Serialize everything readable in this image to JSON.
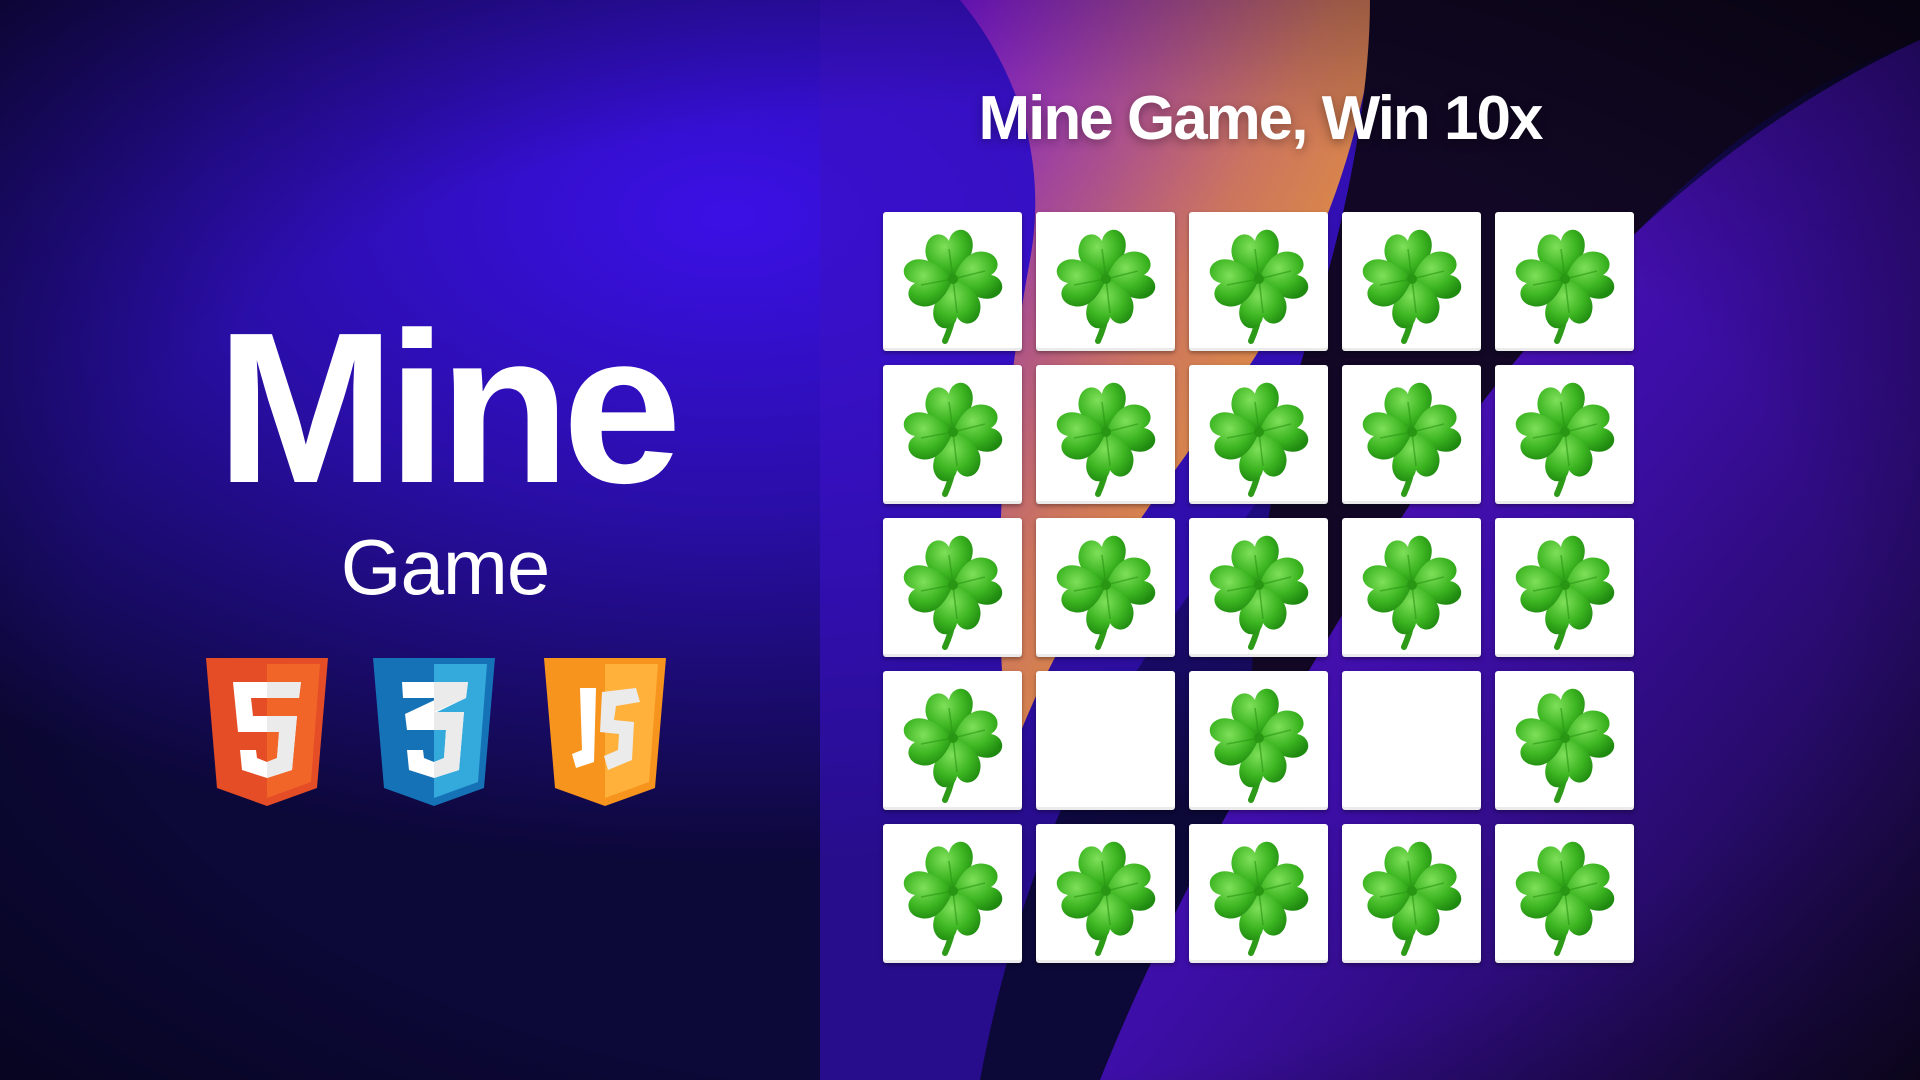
{
  "hero": {
    "title": "Mine",
    "subtitle": "Game",
    "badges": [
      {
        "name": "html5-icon",
        "glyph": "5",
        "color_light": "#f16529",
        "color_dark": "#e44d26"
      },
      {
        "name": "css3-icon",
        "glyph": "3",
        "color_light": "#33a9dc",
        "color_dark": "#1572b6"
      },
      {
        "name": "javascript-icon",
        "glyph": "JS",
        "color_light": "#ffb13b",
        "color_dark": "#f7941d"
      }
    ]
  },
  "game": {
    "title": "Mine Game, Win 10x",
    "grid": {
      "rows": 5,
      "columns": 5,
      "tiles": [
        "clover",
        "clover",
        "clover",
        "clover",
        "clover",
        "clover",
        "clover",
        "clover",
        "clover",
        "clover",
        "clover",
        "clover",
        "clover",
        "clover",
        "clover",
        "clover",
        "empty",
        "clover",
        "empty",
        "clover",
        "clover",
        "clover",
        "clover",
        "clover",
        "clover"
      ]
    },
    "tile_icon": "four-leaf-clover-icon"
  },
  "colors": {
    "background_dark": "#0d0840",
    "background_blue": "#3a14d6",
    "accent_orange": "#f0a43a",
    "accent_purple": "#8b2bd8",
    "tile": "#ffffff",
    "clover": "#3cb521"
  }
}
